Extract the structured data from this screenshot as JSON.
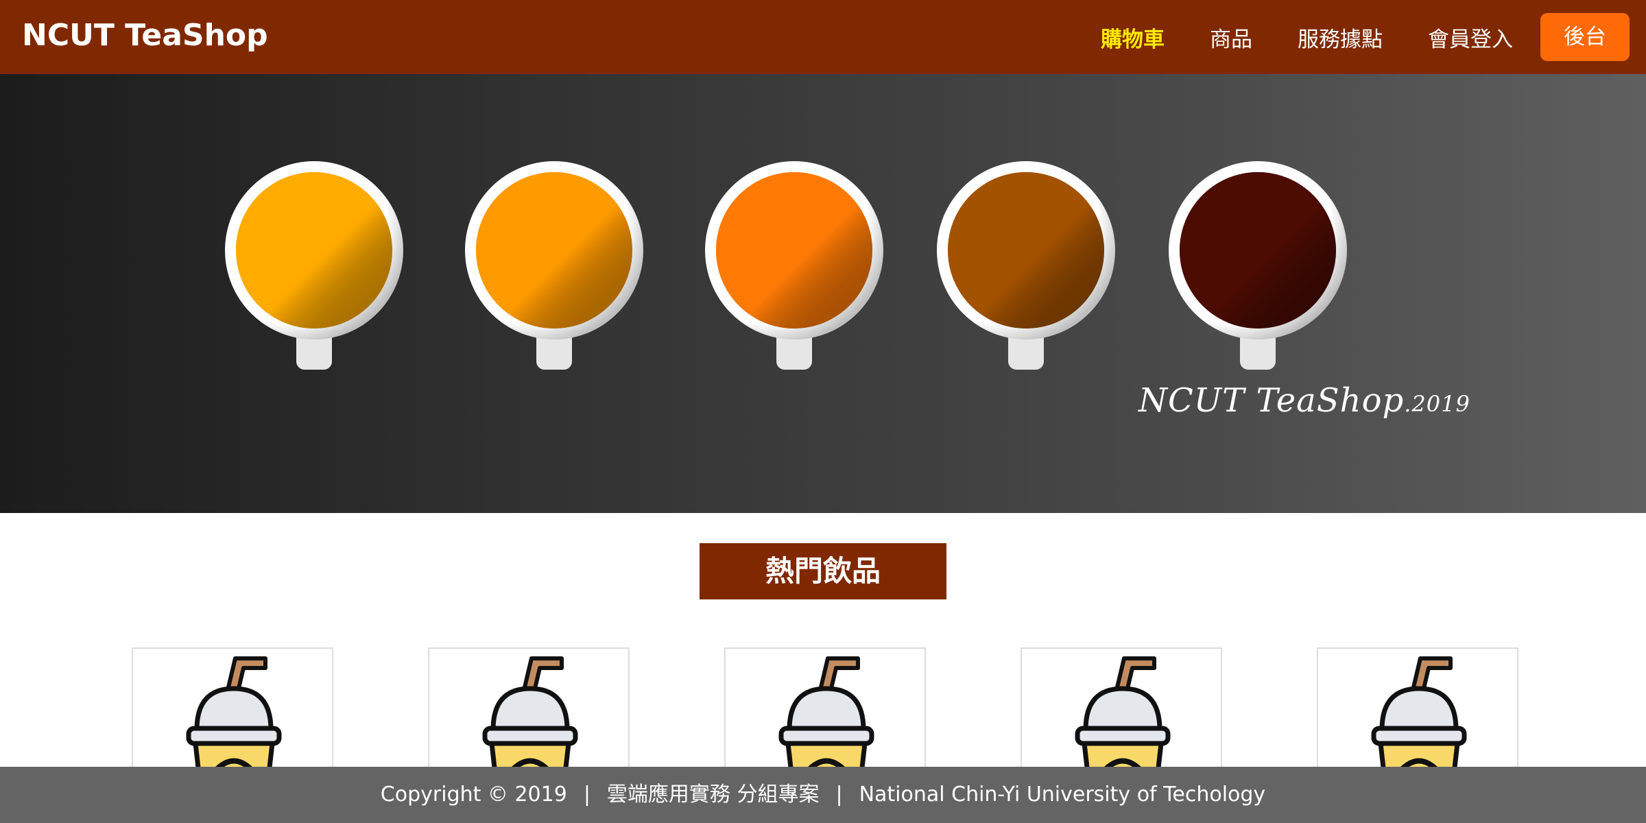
{
  "header": {
    "brand": "NCUT TeaShop",
    "nav": [
      {
        "label": "購物車",
        "active": true
      },
      {
        "label": "商品",
        "active": false
      },
      {
        "label": "服務據點",
        "active": false
      },
      {
        "label": "會員登入",
        "active": false
      }
    ],
    "admin_button": "後台"
  },
  "hero": {
    "signature": "NCUT TeaShop",
    "signature_year": ".2019",
    "tea_colors": [
      "#ffab00",
      "#ff9a00",
      "#ff7a05",
      "#a35200",
      "#4c0c02"
    ]
  },
  "section": {
    "title": "熱門飲品"
  },
  "products": [
    {
      "icon": "drink-cup-icon"
    },
    {
      "icon": "drink-cup-icon"
    },
    {
      "icon": "drink-cup-icon"
    },
    {
      "icon": "drink-cup-icon"
    },
    {
      "icon": "drink-cup-icon"
    }
  ],
  "footer": {
    "copyright": "Copyright © 2019",
    "sep1": "|",
    "project": "雲端應用實務 分組專案",
    "sep2": "|",
    "school": "National Chin-Yi University of Techology"
  },
  "colors": {
    "header_bg": "#802800",
    "active_nav": "#ffea00",
    "admin_button_bg": "#ff6a08",
    "footer_bg": "#646464"
  }
}
